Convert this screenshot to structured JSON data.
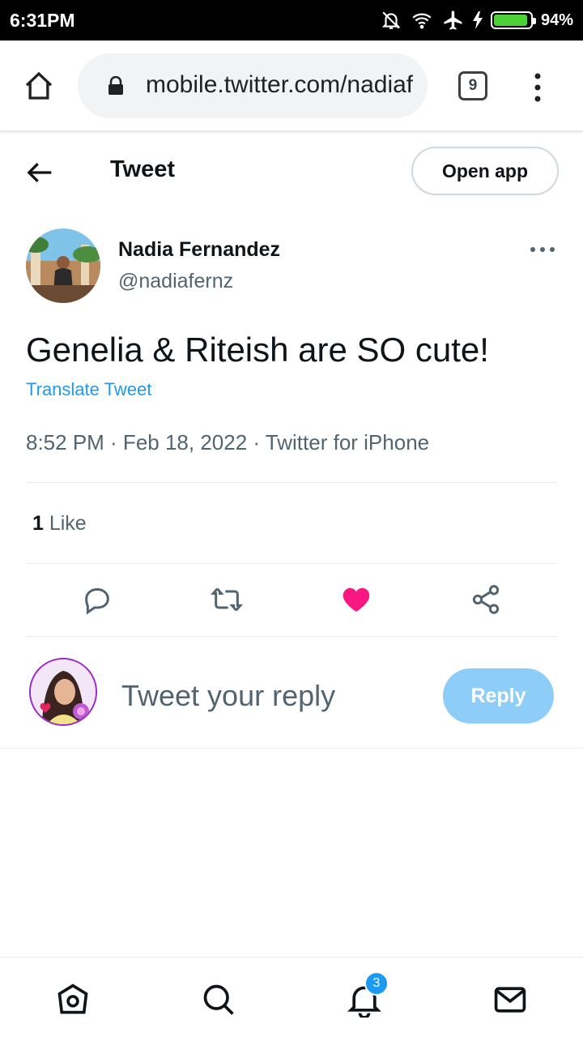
{
  "status_bar": {
    "time": "6:31PM",
    "battery": "94%",
    "battery_level": 0.94
  },
  "browser": {
    "url": "mobile.twitter.com/nadiafernz/status",
    "tab_count": "9"
  },
  "header": {
    "title": "Tweet",
    "open_app_label": "Open app"
  },
  "tweet": {
    "author_name": "Nadia Fernandez",
    "author_handle": "@nadiafernz",
    "text": "Genelia & Riteish are SO cute!",
    "translate_label": "Translate Tweet",
    "meta": "8:52 PM · Feb 18, 2022 · Twitter for iPhone",
    "likes_count": "1",
    "likes_label": " Like"
  },
  "actions": [
    "reply-icon",
    "retweet-icon",
    "like-icon",
    "share-icon"
  ],
  "reply": {
    "placeholder": "Tweet your reply",
    "button_label": "Reply"
  },
  "bottom_nav": {
    "items": [
      "home-icon",
      "search-icon",
      "notifications-icon",
      "messages-icon"
    ],
    "notification_badge": "3"
  },
  "colors": {
    "accent": "#1d9bf0",
    "like": "#f91880",
    "reply_button": "#8ecdf8",
    "secondary_text": "#536471"
  }
}
